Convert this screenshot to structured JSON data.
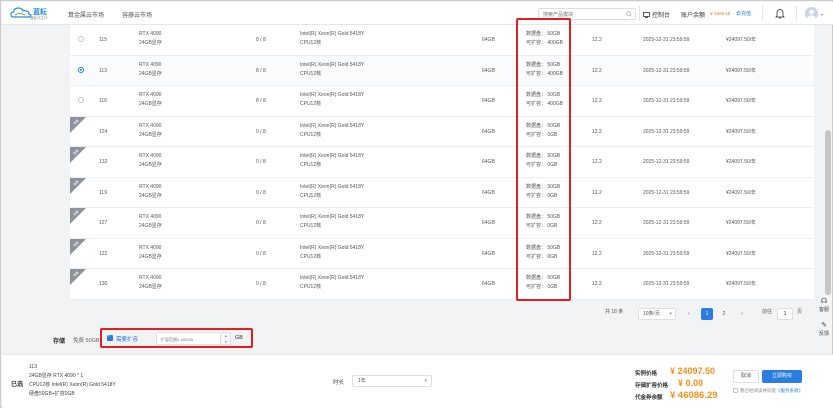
{
  "header": {
    "logo_brand": "蓝耘",
    "logo_sub": "蓝耘元生代",
    "nav": [
      "算金属云市场",
      "容器云市场"
    ],
    "search_placeholder": "搜索产品模块",
    "console": "控制台",
    "balance_label": "账户余额",
    "balance_amount": "¥-1506.45",
    "recharge": "去充值"
  },
  "table": {
    "rows": [
      {
        "id": "115",
        "gpu": "RTX 4090",
        "mem": "24GB显存",
        "avail": "8 / 8",
        "cpu": "Intel(R) Xeon(R) Gold 5418Y",
        "cores": "CPU12核",
        "ram": "64GB",
        "disk1": "数据盘： 50GB",
        "disk2": "可扩容： 400GB",
        "cuda": "12.2",
        "expire": "2025-12-31 23:59:59",
        "price": "¥24097.50/年",
        "selected": false,
        "soldout": false
      },
      {
        "id": "113",
        "gpu": "RTX 4090",
        "mem": "24GB显存",
        "avail": "8 / 8",
        "cpu": "Intel(R) Xeon(R) Gold 5418Y",
        "cores": "CPU12核",
        "ram": "64GB",
        "disk1": "数据盘： 50GB",
        "disk2": "可扩容： 400GB",
        "cuda": "12.2",
        "expire": "2025-12-31 23:59:59",
        "price": "¥24097.50/年",
        "selected": true,
        "soldout": false
      },
      {
        "id": "116",
        "gpu": "RTX 4090",
        "mem": "24GB显存",
        "avail": "8 / 8",
        "cpu": "Intel(R) Xeon(R) Gold 5418Y",
        "cores": "CPU12核",
        "ram": "64GB",
        "disk1": "数据盘： 50GB",
        "disk2": "可扩容： 400GB",
        "cuda": "12.2",
        "expire": "2025-12-31 23:59:59",
        "price": "¥24097.50/年",
        "selected": false,
        "soldout": false
      },
      {
        "id": "124",
        "gpu": "RTX 4090",
        "mem": "24GB显存",
        "avail": "0 / 8",
        "cpu": "Intel(R) Xeon(R) Gold 5418Y",
        "cores": "CPU12核",
        "ram": "64GB",
        "disk1": "数据盘： 50GB",
        "disk2": "可扩容： 0GB",
        "cuda": "12.2",
        "expire": "2025-12-31 23:59:59",
        "price": "¥24097.50/年",
        "selected": false,
        "soldout": true
      },
      {
        "id": "132",
        "gpu": "RTX 4090",
        "mem": "24GB显存",
        "avail": "0 / 8",
        "cpu": "Intel(R) Xeon(R) Gold 5418Y",
        "cores": "CPU12核",
        "ram": "64GB",
        "disk1": "数据盘： 50GB",
        "disk2": "可扩容： 0GB",
        "cuda": "12.2",
        "expire": "2025-12-31 23:59:59",
        "price": "¥24097.50/年",
        "selected": false,
        "soldout": true
      },
      {
        "id": "119",
        "gpu": "RTX 4090",
        "mem": "24GB显存",
        "avail": "0 / 8",
        "cpu": "Intel(R) Xeon(R) Gold 5418Y",
        "cores": "CPU12核",
        "ram": "64GB",
        "disk1": "数据盘： 50GB",
        "disk2": "可扩容： 0GB",
        "cuda": "12.2",
        "expire": "2025-12-31 23:59:59",
        "price": "¥24097.50/年",
        "selected": false,
        "soldout": true
      },
      {
        "id": "127",
        "gpu": "RTX 4090",
        "mem": "24GB显存",
        "avail": "0 / 8",
        "cpu": "Intel(R) Xeon(R) Gold 5418Y",
        "cores": "CPU12核",
        "ram": "64GB",
        "disk1": "数据盘： 50GB",
        "disk2": "可扩容： 0GB",
        "cuda": "12.2",
        "expire": "2025-12-31 23:59:59",
        "price": "¥24097.50/年",
        "selected": false,
        "soldout": true
      },
      {
        "id": "122",
        "gpu": "RTX 4090",
        "mem": "24GB显存",
        "avail": "0 / 8",
        "cpu": "Intel(R) Xeon(R) Gold 5418Y",
        "cores": "CPU12核",
        "ram": "64GB",
        "disk1": "数据盘： 50GB",
        "disk2": "可扩容： 0GB",
        "cuda": "12.2",
        "expire": "2025-12-31 23:59:59",
        "price": "¥24097.50/年",
        "selected": false,
        "soldout": true
      },
      {
        "id": "130",
        "gpu": "RTX 4090",
        "mem": "24GB显存",
        "avail": "0 / 8",
        "cpu": "Intel(R) Xeon(R) Gold 5418Y",
        "cores": "CPU12核",
        "ram": "64GB",
        "disk1": "数据盘： 50GB",
        "disk2": "可扩容： 0GB",
        "cuda": "12.2",
        "expire": "2025-12-31 23:59:59",
        "price": "¥24097.50/年",
        "selected": false,
        "soldout": true
      }
    ],
    "soldout_tag": "售罄"
  },
  "pagination": {
    "total": "共 18 条",
    "page_size": "10条/页",
    "prev": "‹",
    "pages": [
      "1",
      "2"
    ],
    "next": "›",
    "jump_label": "前往",
    "jump_value": "1",
    "jump_unit": "页"
  },
  "storage": {
    "label": "存储",
    "free": "免费 50GB",
    "expand": "需要扩容",
    "placeholder": "扩容范围0-400GB",
    "unit": "GB"
  },
  "side": {
    "help": "客服",
    "feedback": "反馈"
  },
  "bottom": {
    "selected_label": "已选",
    "lines": [
      "113",
      "24GB显存 RTX 4090 * 1",
      "CPU12核 Intel(R) Xeon(R) Gold 5418Y",
      "硬盘50GB+扩容0GB"
    ],
    "duration_label": "时长",
    "duration_value": "1年",
    "actual_label": "实例价格",
    "actual_value": "¥ 24097.50",
    "storage_price_label": "存储扩容价格",
    "storage_price_value": "¥ 0.00",
    "total_label": "代金券余额",
    "total_value": "¥ 46086.29",
    "cancel": "取消",
    "buy": "立即购买",
    "agree_text": "我已经阅读并同意",
    "agree_link": "《服务条款》"
  },
  "colors": {
    "accent": "#2a7de1",
    "price": "#f39019",
    "highlight": "#e02020"
  }
}
